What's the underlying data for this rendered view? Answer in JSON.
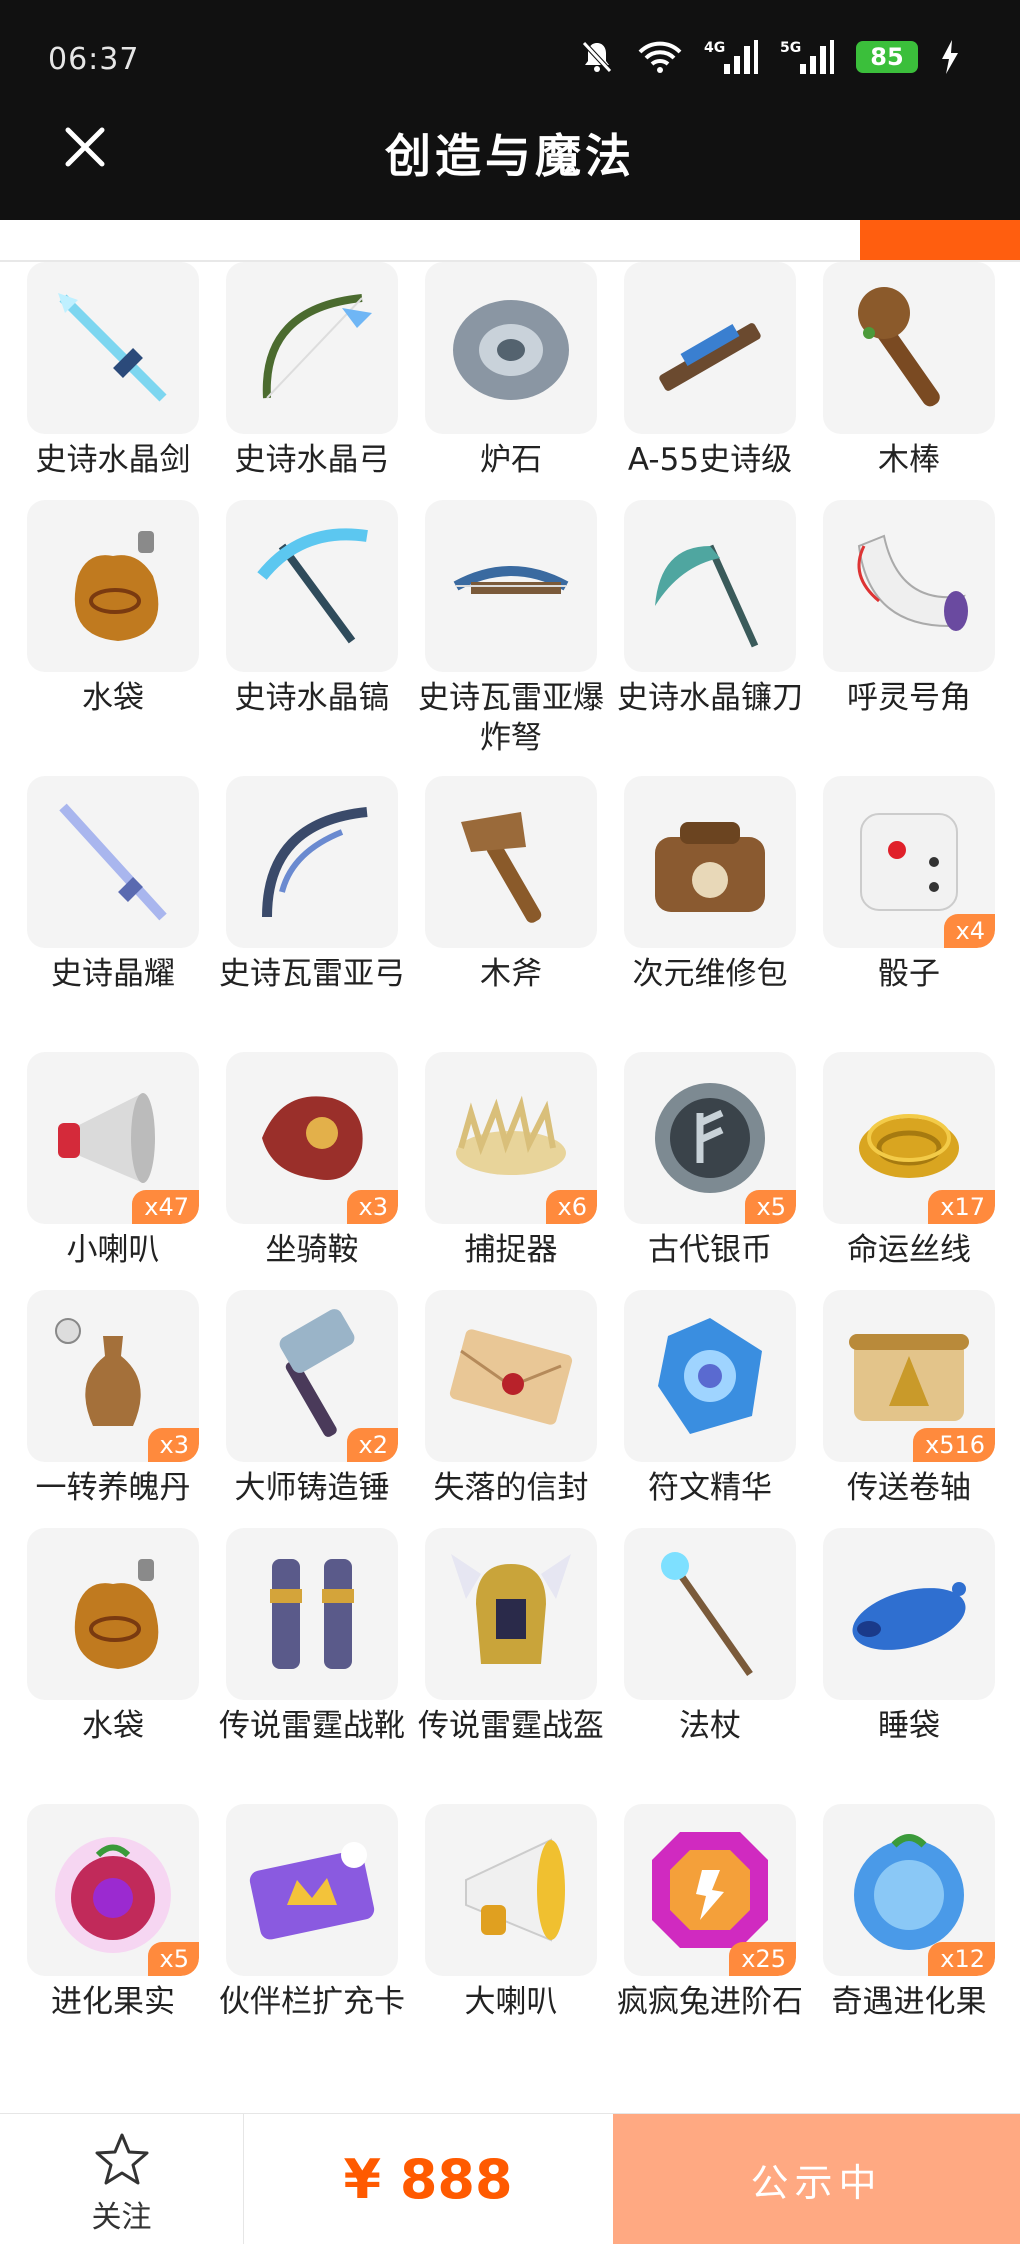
{
  "status_bar": {
    "time": "06:37",
    "battery": "85",
    "network1": "4G",
    "network2": "5G"
  },
  "header": {
    "title": "创造与魔法",
    "close_icon": "close-icon"
  },
  "items": [
    {
      "label": "史诗水晶剑",
      "badge": "",
      "icon": "crystal-sword"
    },
    {
      "label": "史诗水晶弓",
      "badge": "",
      "icon": "crystal-bow"
    },
    {
      "label": "炉石",
      "badge": "",
      "icon": "hearthstone"
    },
    {
      "label": "A-55史诗级",
      "badge": "",
      "icon": "rifle"
    },
    {
      "label": "木棒",
      "badge": "",
      "icon": "club"
    },
    {
      "label": "水袋",
      "badge": "",
      "icon": "water-bag"
    },
    {
      "label": "史诗水晶镐",
      "badge": "",
      "icon": "crystal-pickaxe"
    },
    {
      "label": "史诗瓦雷亚爆炸弩",
      "badge": "",
      "icon": "crossbow"
    },
    {
      "label": "史诗水晶镰刀",
      "badge": "",
      "icon": "scythe"
    },
    {
      "label": "呼灵号角",
      "badge": "",
      "icon": "horn"
    },
    {
      "label": "史诗晶耀",
      "badge": "",
      "icon": "glow-sword"
    },
    {
      "label": "史诗瓦雷亚弓",
      "badge": "",
      "icon": "dark-bow"
    },
    {
      "label": "木斧",
      "badge": "",
      "icon": "wood-axe"
    },
    {
      "label": "次元维修包",
      "badge": "",
      "icon": "repair-bag"
    },
    {
      "label": "骰子",
      "badge": "x4",
      "icon": "dice"
    },
    {
      "label": "小喇叭",
      "badge": "x47",
      "icon": "megaphone"
    },
    {
      "label": "坐骑鞍",
      "badge": "x3",
      "icon": "saddle"
    },
    {
      "label": "捕捉器",
      "badge": "x6",
      "icon": "trap"
    },
    {
      "label": "古代银币",
      "badge": "x5",
      "icon": "coin"
    },
    {
      "label": "命运丝线",
      "badge": "x17",
      "icon": "rope"
    },
    {
      "label": "一转养魄丹",
      "badge": "x3",
      "icon": "vase"
    },
    {
      "label": "大师铸造锤",
      "badge": "x2",
      "icon": "hammer"
    },
    {
      "label": "失落的信封",
      "badge": "",
      "icon": "envelope"
    },
    {
      "label": "符文精华",
      "badge": "",
      "icon": "rune-crystal"
    },
    {
      "label": "传送卷轴",
      "badge": "x516",
      "icon": "scroll"
    },
    {
      "label": "水袋",
      "badge": "",
      "icon": "water-bag"
    },
    {
      "label": "传说雷霆战靴",
      "badge": "",
      "icon": "boots"
    },
    {
      "label": "传说雷霆战盔",
      "badge": "",
      "icon": "helmet"
    },
    {
      "label": "法杖",
      "badge": "",
      "icon": "staff"
    },
    {
      "label": "睡袋",
      "badge": "",
      "icon": "sleeping-bag"
    },
    {
      "label": "进化果实",
      "badge": "x5",
      "icon": "fruit"
    },
    {
      "label": "伙伴栏扩充卡",
      "badge": "",
      "icon": "card"
    },
    {
      "label": "大喇叭",
      "badge": "",
      "icon": "big-megaphone"
    },
    {
      "label": "疯疯兔进阶石",
      "badge": "x25",
      "icon": "gem"
    },
    {
      "label": "奇遇进化果",
      "badge": "x12",
      "icon": "blue-fruit"
    }
  ],
  "bottom_bar": {
    "follow_label": "关注",
    "price": "¥ 888",
    "status_button": "公示中"
  },
  "colors": {
    "accent": "#ff5e0f",
    "badge": "#ff8a3d",
    "price": "#ff5a00",
    "status_button": "#ffa982"
  }
}
